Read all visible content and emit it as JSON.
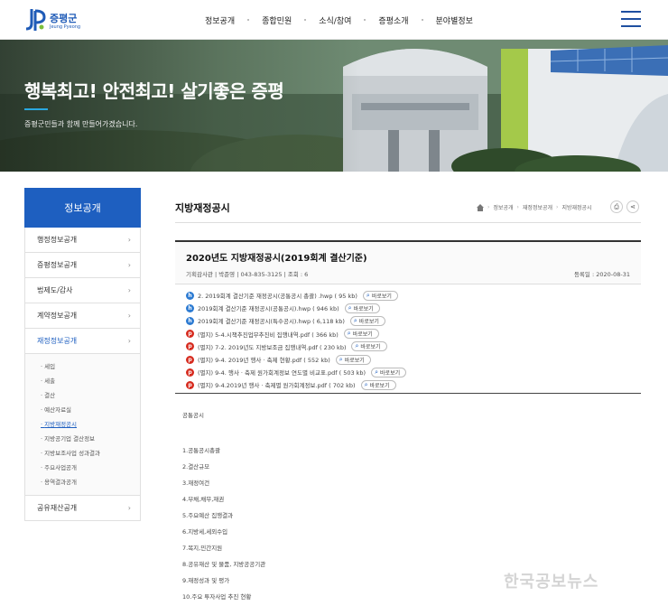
{
  "logo": {
    "main": "증평군",
    "sub": "Jeung Pyeong"
  },
  "gnb": [
    "정보공개",
    "종합민원",
    "소식/참여",
    "증평소개",
    "분야별정보"
  ],
  "hero": {
    "title": "행복최고! 안전최고! 살기좋은 증평",
    "subtitle": "증평군민들과 함께 만들어가겠습니다."
  },
  "lnb": {
    "heading": "정보공개",
    "items": [
      {
        "label": "행정정보공개",
        "arrow": "›"
      },
      {
        "label": "증평정보공개",
        "arrow": "›"
      },
      {
        "label": "법제도/감사",
        "arrow": "›"
      },
      {
        "label": "계약정보공개",
        "arrow": "›"
      },
      {
        "label": "재정정보공개",
        "arrow": "›"
      }
    ],
    "sub_items": [
      "세입",
      "세출",
      "결산",
      "예산자료실",
      "지방재정공시",
      "지방공기업 결산정보",
      "지방보조사업 성과결과",
      "주요사업공개",
      "용역결과공개"
    ],
    "last_item": {
      "label": "공유재산공개",
      "arrow": "›"
    }
  },
  "page": {
    "title": "지방재정공시",
    "breadcrumb": [
      "정보공개",
      "재정정보공개",
      "지방재정공시"
    ]
  },
  "board": {
    "title": "2020년도 지방재정공시(2019회계 결산기준)",
    "meta": "기획감사관 | 박준영 | 043-835-3125  |  조회 : 6",
    "date": "등록일 : 2020-08-31",
    "view_label": "바로보기",
    "files": [
      {
        "type": "hwp",
        "name": "2. 2019회계 결산기준 재정공시(공통공시 총괄) .hwp ( 95 kb)"
      },
      {
        "type": "hwp",
        "name": "2019회계 결산기준 재정공시(공통공시).hwp ( 946 kb)"
      },
      {
        "type": "hwp",
        "name": "2019회계 결산기준 재정공시(특수공시).hwp ( 6,118 kb)"
      },
      {
        "type": "pdf",
        "name": "(별지) 5-4.시책추진업무추진비 집행내역.pdf ( 366 kb)"
      },
      {
        "type": "pdf",
        "name": "(별지) 7-2. 2019년도 지방보조금 집행내역.pdf ( 230 kb)"
      },
      {
        "type": "pdf",
        "name": "(별지) 9-4. 2019년 행사 · 축제 현황.pdf ( 552 kb)"
      },
      {
        "type": "pdf",
        "name": "(별지) 9-4. 행사 · 축제 원가회계정보 연도별 비교표.pdf ( 503 kb)"
      },
      {
        "type": "pdf",
        "name": "(별지) 9-4.2019년 행사 · 축제별 원가회계정보.pdf ( 702 kb)"
      }
    ],
    "body_heading": "공통공시",
    "body_items": [
      "1.공통공시총괄",
      "2.결산규모",
      "3.재정여건",
      "4.부채,채무,재권",
      "5.주요예산 집행결과",
      "6.지방세,세외수입",
      "7.복지,민간지원",
      "8.공유재산 및 물품, 지방공공기관",
      "9.재정성과 및 평가",
      "10.주요 투자사업 추진 현황"
    ]
  },
  "watermark": "한국공보뉴스"
}
